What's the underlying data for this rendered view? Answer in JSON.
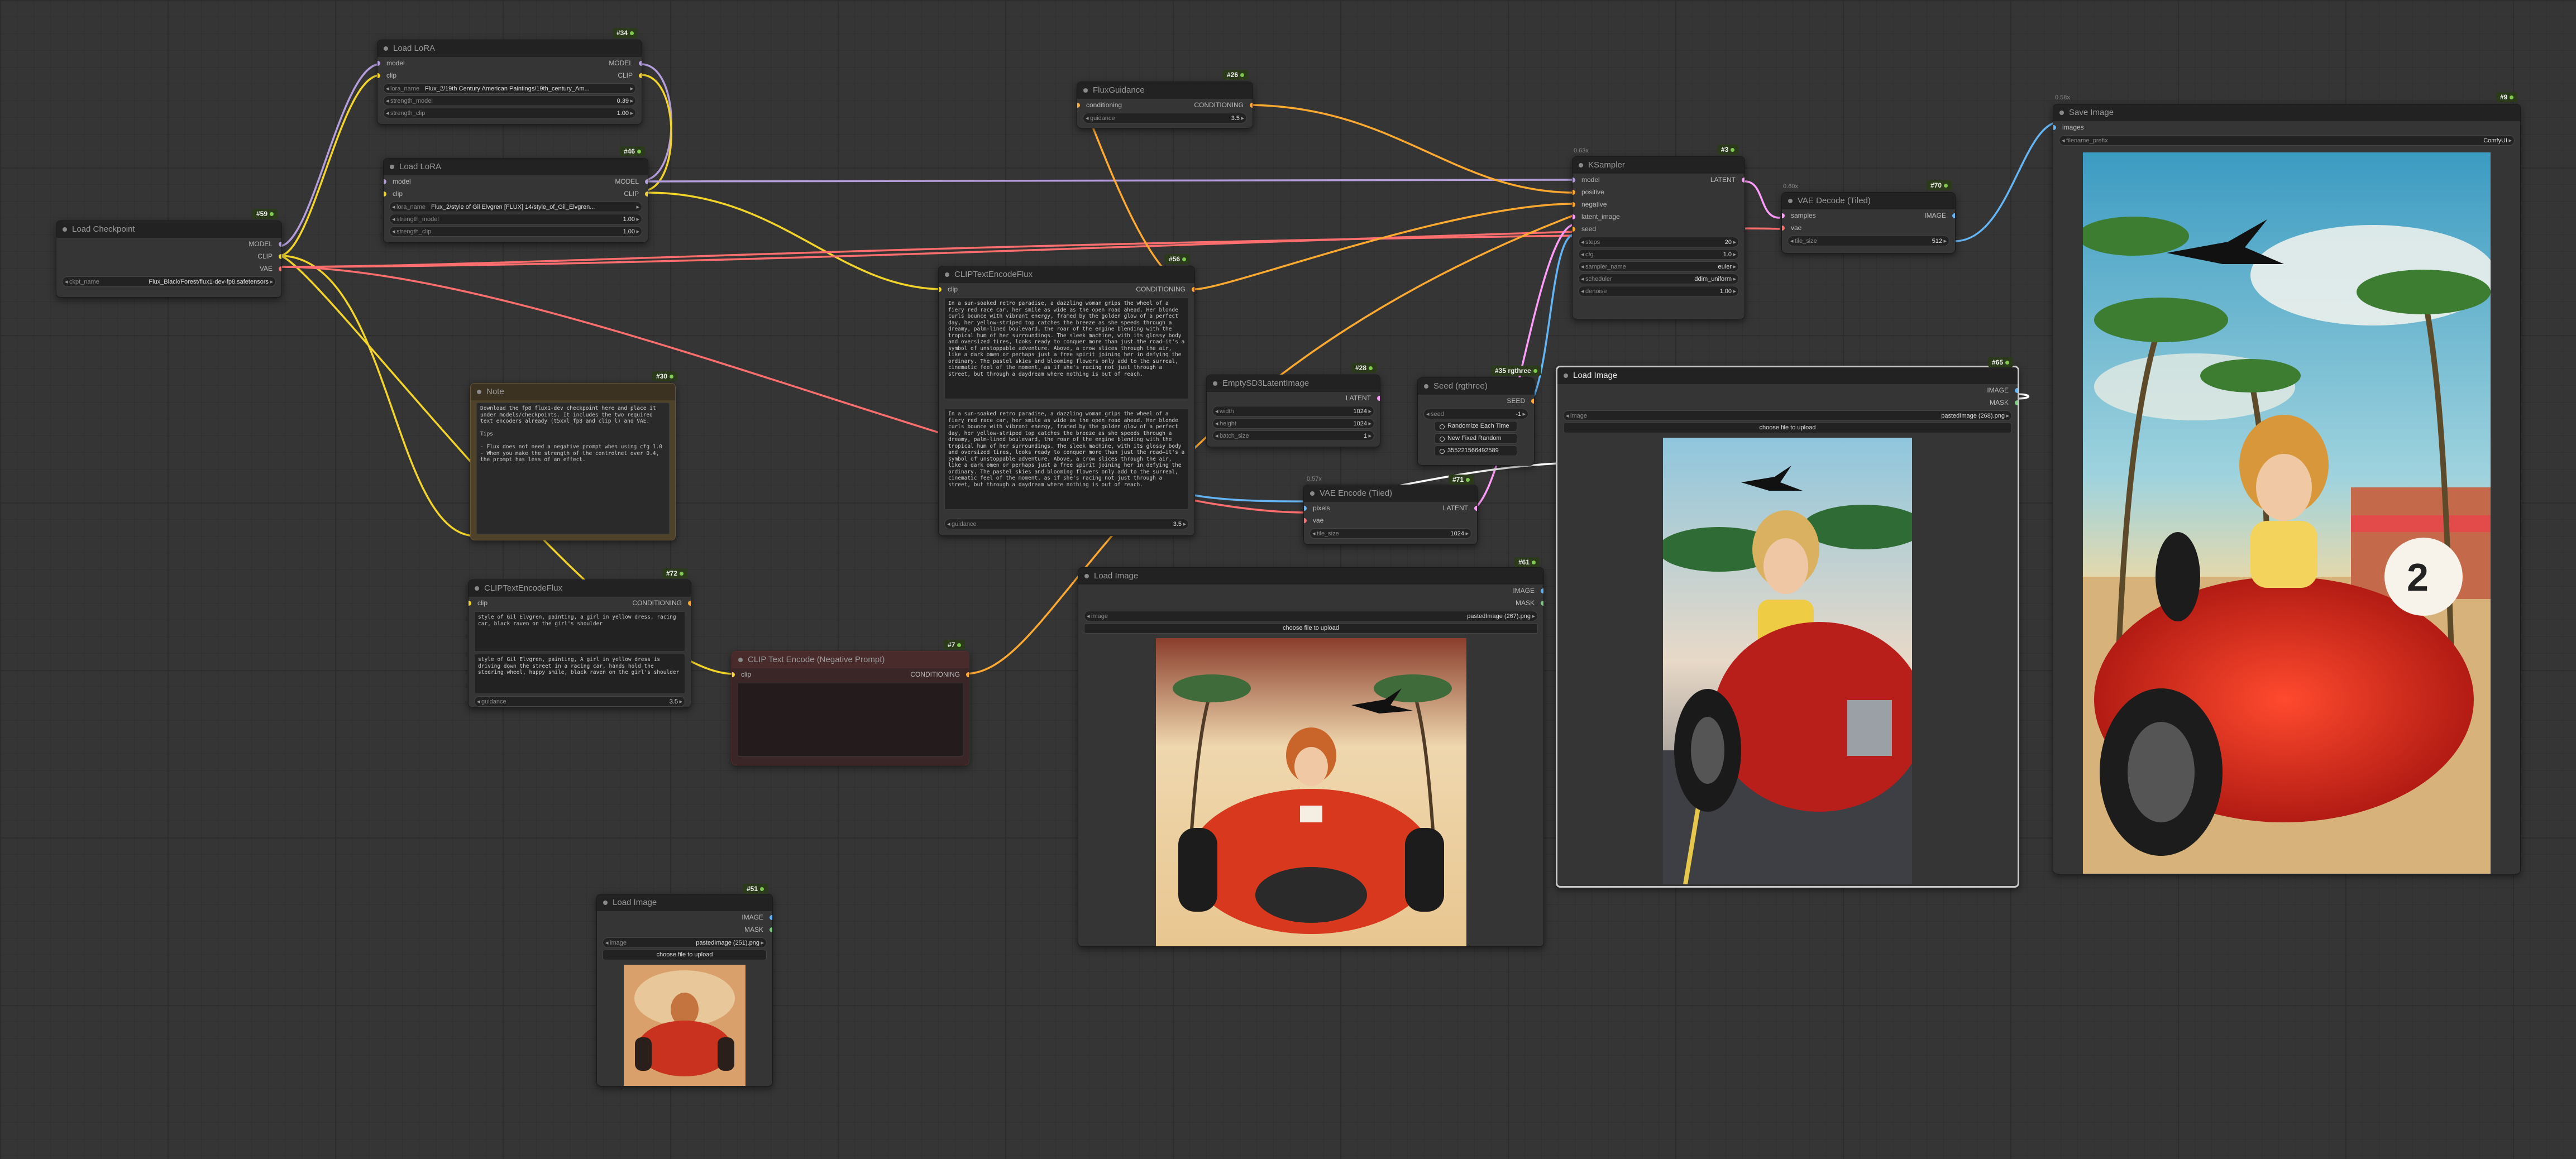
{
  "nodes": {
    "load_lora_1": {
      "id": "#34",
      "title": "Load LoRA",
      "inputs": [
        "model",
        "clip"
      ],
      "outputs": [
        "MODEL",
        "CLIP"
      ],
      "widgets": [
        {
          "label": "lora_name",
          "value": "Flux_2/19th Century American Paintings/19th_century_Am..."
        },
        {
          "label": "strength_model",
          "value": "0.39"
        },
        {
          "label": "strength_clip",
          "value": "1.00"
        }
      ]
    },
    "load_lora_2": {
      "id": "#46",
      "title": "Load LoRA",
      "inputs": [
        "model",
        "clip"
      ],
      "outputs": [
        "MODEL",
        "CLIP"
      ],
      "widgets": [
        {
          "label": "lora_name",
          "value": "Flux_2/style of Gil Elvgren [FLUX] 14/style_of_Gil_Elvgren..."
        },
        {
          "label": "strength_model",
          "value": "1.00"
        },
        {
          "label": "strength_clip",
          "value": "1.00"
        }
      ]
    },
    "load_checkpoint": {
      "id": "#59",
      "title": "Load Checkpoint",
      "outputs": [
        "MODEL",
        "CLIP",
        "VAE"
      ],
      "widgets": [
        {
          "label": "ckpt_name",
          "value": "Flux_Black/Forest/flux1-dev-fp8.safetensors"
        }
      ]
    },
    "flux_guidance": {
      "id": "#26",
      "title": "FluxGuidance",
      "inputs": [
        "conditioning"
      ],
      "outputs": [
        "CONDITIONING"
      ],
      "widgets": [
        {
          "label": "guidance",
          "value": "3.5"
        }
      ]
    },
    "clip_text_encode_flux_main": {
      "id": "#56",
      "title": "CLIPTextEncodeFlux",
      "inputs": [
        "clip"
      ],
      "outputs": [
        "CONDITIONING"
      ],
      "text1": "In a sun-soaked retro paradise, a dazzling woman grips the wheel of a fiery red race car, her smile as wide as the open road ahead. Her blonde curls bounce with vibrant energy, framed by the golden glow of a perfect day, her yellow-striped top catches the breeze as she speeds through a dreamy, palm-lined boulevard, the roar of the engine blending with the tropical hum of her surroundings. The sleek machine, with its glossy body and oversized tires, looks ready to conquer more than just the road—it's a symbol of unstoppable adventure. Above, a crow slices through the air, like a dark omen or perhaps just a free spirit joining her in defying the ordinary. The pastel skies and blooming flowers only add to the surreal, cinematic feel of the moment, as if she's racing not just through a street, but through a daydream where nothing is out of reach.",
      "text2": "In a sun-soaked retro paradise, a dazzling woman grips the wheel of a fiery red race car, her smile as wide as the open road ahead. Her blonde curls bounce with vibrant energy, framed by the golden glow of a perfect day, her yellow-striped top catches the breeze as she speeds through a dreamy, palm-lined boulevard, the roar of the engine blending with the tropical hum of her surroundings. The sleek machine, with its glossy body and oversized tires, looks ready to conquer more than just the road—it's a symbol of unstoppable adventure. Above, a crow slices through the air, like a dark omen or perhaps just a free spirit joining her in defying the ordinary. The pastel skies and blooming flowers only add to the surreal, cinematic feel of the moment, as if she's racing not just through a street, but through a daydream where nothing is out of reach.",
      "widgets": [
        {
          "label": "guidance",
          "value": "3.5"
        }
      ]
    },
    "note": {
      "id": "#30",
      "title": "Note",
      "text": "Download the fp8 flux1-dev checkpoint here and place it under models/checkpoints. It includes the two required text encoders already (t5xxl_fp8 and clip_l) and VAE.\n\nTips\n\n- Flux does not need a negative prompt when using cfg 1.0\n- When you make the strength of the controlnet over 0.4, the prompt has less of an effect."
    },
    "empty_latent": {
      "id": "#28",
      "title": "EmptySD3LatentImage",
      "outputs": [
        "LATENT"
      ],
      "widgets": [
        {
          "label": "width",
          "value": "1024"
        },
        {
          "label": "height",
          "value": "1024"
        },
        {
          "label": "batch_size",
          "value": "1"
        }
      ]
    },
    "seed": {
      "id": "#35 rgthree",
      "title": "Seed (rgthree)",
      "outputs": [
        "SEED"
      ],
      "widgets": [
        {
          "label": "seed",
          "value": "-1"
        }
      ],
      "buttons": [
        "Randomize Each Time",
        "New Fixed Random",
        "Use Last Queued Seed"
      ],
      "last_seed": "355221566492589"
    },
    "ksampler": {
      "id": "#3",
      "group": "0.63x",
      "title": "KSampler",
      "inputs": [
        "model",
        "positive",
        "negative",
        "latent_image",
        "seed"
      ],
      "outputs": [
        "LATENT"
      ],
      "widgets": [
        {
          "label": "steps",
          "value": "20"
        },
        {
          "label": "cfg",
          "value": "1.0"
        },
        {
          "label": "sampler_name",
          "value": "euler"
        },
        {
          "label": "scheduler",
          "value": "ddim_uniform"
        },
        {
          "label": "denoise",
          "value": "1.00"
        }
      ]
    },
    "vae_decode": {
      "id": "#70",
      "group": "0.60x",
      "title": "VAE Decode (Tiled)",
      "inputs": [
        "samples",
        "vae"
      ],
      "outputs": [
        "IMAGE"
      ],
      "widgets": [
        {
          "label": "tile_size",
          "value": "512"
        }
      ]
    },
    "save_image": {
      "id": "#9",
      "group": "0.58x",
      "title": "Save Image",
      "inputs": [
        "images"
      ],
      "widgets": [
        {
          "label": "filename_prefix",
          "value": "ComfyUI"
        }
      ]
    },
    "load_image_main": {
      "id": "#65",
      "title": "Load Image",
      "outputs": [
        "IMAGE",
        "MASK"
      ],
      "widgets": [
        {
          "label": "image",
          "value": "pastedImage (268).png"
        }
      ],
      "upload_label": "choose file to upload"
    },
    "vae_encode": {
      "id": "#71",
      "group": "0.57x",
      "title": "VAE Encode (Tiled)",
      "inputs": [
        "pixels",
        "vae"
      ],
      "outputs": [
        "LATENT"
      ],
      "widgets": [
        {
          "label": "tile_size",
          "value": "1024"
        }
      ]
    },
    "load_image_mid": {
      "id": "#61",
      "title": "Load Image",
      "outputs": [
        "IMAGE",
        "MASK"
      ],
      "widgets": [
        {
          "label": "image",
          "value": "pastedImage (267).png"
        }
      ],
      "upload_label": "choose file to upload"
    },
    "clip_text_encode_flux_small": {
      "id": "#72",
      "title": "CLIPTextEncodeFlux",
      "inputs": [
        "clip"
      ],
      "outputs": [
        "CONDITIONING"
      ],
      "text1": "style of Gil Elvgren, painting, a girl in yellow dress, racing car, black raven on the girl's shoulder",
      "text2": "style of Gil Elvgren, painting, A girl in yellow dress is driving down the street in a racing car, hands hold the steering wheel, happy smile, black raven on the girl's shoulder",
      "widgets": [
        {
          "label": "guidance",
          "value": "3.5"
        }
      ]
    },
    "clip_negative": {
      "id": "#7",
      "title": "CLIP Text Encode (Negative Prompt)",
      "inputs": [
        "clip"
      ],
      "outputs": [
        "CONDITIONING"
      ]
    },
    "load_image_small": {
      "id": "#51",
      "title": "Load Image",
      "outputs": [
        "IMAGE",
        "MASK"
      ],
      "widgets": [
        {
          "label": "image",
          "value": "pastedImage (251).png"
        }
      ],
      "upload_label": "choose file to upload"
    }
  },
  "colors": {
    "model": "#b39ddb",
    "clip": "#f2d42b",
    "vae": "#ff6e6e",
    "conditioning": "#ffa931",
    "latent": "#ff9cf9",
    "image": "#64b5f6",
    "mask": "#81c784"
  }
}
